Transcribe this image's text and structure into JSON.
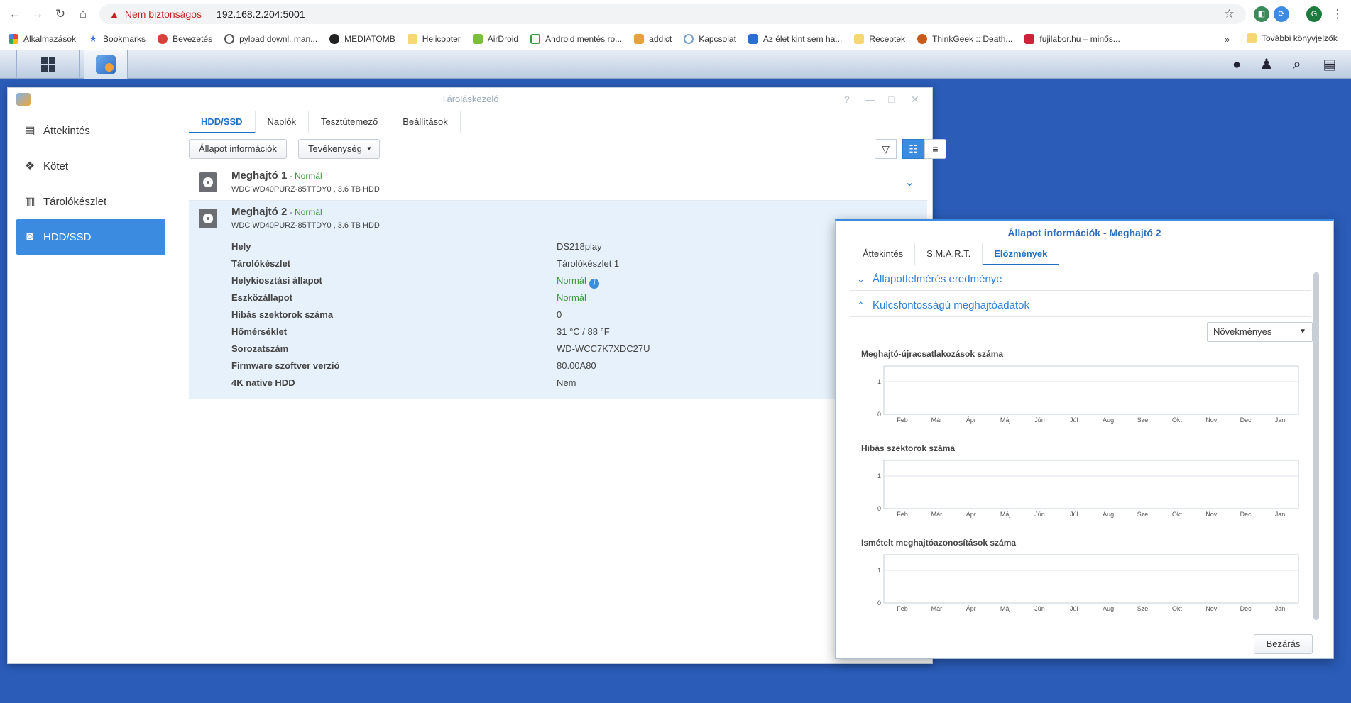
{
  "browser": {
    "security_text": "Nem biztonságos",
    "url": "192.168.2.204:5001",
    "profile_initial": "G",
    "bookmarks": [
      "Alkalmazások",
      "Bookmarks",
      "Bevezetés",
      "pyload downl. man...",
      "MEDIATOMB",
      "Helicopter",
      "AirDroid",
      "Android mentés ro...",
      "addict",
      "Kapcsolat",
      "Az élet kint sem ha...",
      "Receptek",
      "ThinkGeek :: Death...",
      "fujilabor.hu – minős..."
    ],
    "more": "»",
    "other_bookmarks": "További könyvjelzők"
  },
  "window": {
    "title": "Tároláskezelő",
    "sidebar": [
      "Áttekintés",
      "Kötet",
      "Tárolókészlet",
      "HDD/SSD"
    ],
    "tabs": [
      "HDD/SSD",
      "Naplók",
      "Tesztütemező",
      "Beállítások"
    ],
    "buttons": {
      "status_info": "Állapot információk",
      "action": "Tevékenység"
    },
    "drives": [
      {
        "name": "Meghajtó 1",
        "dash": " - ",
        "status": "Normál",
        "model": "WDC WD40PURZ-85TTDY0 , 3.6 TB HDD"
      },
      {
        "name": "Meghajtó 2",
        "dash": " - ",
        "status": "Normál",
        "model": "WDC WD40PURZ-85TTDY0 , 3.6 TB HDD"
      }
    ],
    "details": [
      {
        "k": "Hely",
        "v": "DS218play"
      },
      {
        "k": "Tárolókészlet",
        "v": "Tárolókészlet 1"
      },
      {
        "k": "Helykiosztási állapot",
        "v": "Normál"
      },
      {
        "k": "Eszközállapot",
        "v": "Normál"
      },
      {
        "k": "Hibás szektorok száma",
        "v": "0"
      },
      {
        "k": "Hőmérséklet",
        "v": "31 °C / 88 °F"
      },
      {
        "k": "Sorozatszám",
        "v": "WD-WCC7K7XDC27U"
      },
      {
        "k": "Firmware szoftver verzió",
        "v": "80.00A80"
      },
      {
        "k": "4K native HDD",
        "v": "Nem"
      }
    ]
  },
  "dialog": {
    "title": "Állapot információk - Meghajtó 2",
    "tabs": [
      "Áttekintés",
      "S.M.A.R.T.",
      "Előzmények"
    ],
    "sections": [
      "Állapotfelmérés eredménye",
      "Kulcsfontosságú meghajtóadatok"
    ],
    "select_value": "Növekményes",
    "close_label": "Bezárás"
  },
  "chart_data": [
    {
      "type": "line",
      "title": "Meghajtó-újracsatlakozások száma",
      "x": [
        "Feb",
        "Már",
        "Ápr",
        "Máj",
        "Jún",
        "Júl",
        "Aug",
        "Sze",
        "Okt",
        "Nov",
        "Dec",
        "Jan"
      ],
      "yticks": [
        "1",
        "0"
      ],
      "ylim": [
        0,
        1
      ],
      "series": []
    },
    {
      "type": "line",
      "title": "Hibás szektorok száma",
      "x": [
        "Feb",
        "Már",
        "Ápr",
        "Máj",
        "Jún",
        "Júl",
        "Aug",
        "Sze",
        "Okt",
        "Nov",
        "Dec",
        "Jan"
      ],
      "yticks": [
        "1",
        "0"
      ],
      "ylim": [
        0,
        1
      ],
      "series": []
    },
    {
      "type": "line",
      "title": "Ismételt meghajtóazonosítások száma",
      "x": [
        "Feb",
        "Már",
        "Ápr",
        "Máj",
        "Jún",
        "Júl",
        "Aug",
        "Sze",
        "Okt",
        "Nov",
        "Dec",
        "Jan"
      ],
      "yticks": [
        "1",
        "0"
      ],
      "ylim": [
        0,
        1
      ],
      "series": []
    }
  ]
}
